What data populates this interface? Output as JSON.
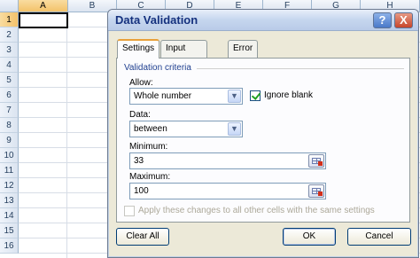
{
  "sheet": {
    "columns": [
      "A",
      "B",
      "C",
      "D",
      "E",
      "F",
      "G",
      "H"
    ],
    "rows": [
      "1",
      "2",
      "3",
      "4",
      "5",
      "6",
      "7",
      "8",
      "9",
      "10",
      "11",
      "12",
      "13",
      "14",
      "15",
      "16"
    ]
  },
  "dialog": {
    "title": "Data Validation",
    "help_glyph": "?",
    "close_glyph": "X",
    "tabs": [
      "Settings",
      "Input Message",
      "Error Alert"
    ],
    "section_title": "Validation criteria",
    "allow_label": "Allow:",
    "allow_value": "Whole number",
    "ignore_blank_label": "Ignore blank",
    "ignore_blank_checked": true,
    "data_label": "Data:",
    "data_value": "between",
    "minimum_label": "Minimum:",
    "minimum_value": "33",
    "maximum_label": "Maximum:",
    "maximum_value": "100",
    "apply_label": "Apply these changes to all other cells with the same settings",
    "clear_all_label": "Clear All",
    "ok_label": "OK",
    "cancel_label": "Cancel"
  },
  "icons": {
    "dropdown": "chevron-down-icon",
    "range_picker": "collapse-dialog-icon"
  },
  "colors": {
    "selected_header": "#f3c26a",
    "title_text": "#15317e",
    "section_text": "#1f3f8f"
  }
}
